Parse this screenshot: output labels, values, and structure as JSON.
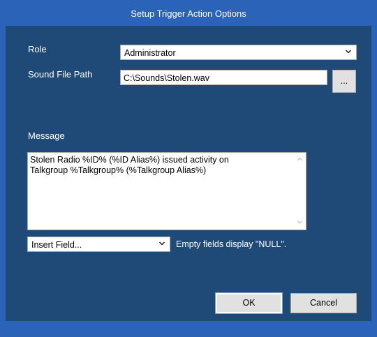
{
  "window": {
    "title": "Setup Trigger Action Options"
  },
  "role": {
    "label": "Role",
    "value": "Administrator"
  },
  "sound": {
    "label": "Sound File Path",
    "value": "C:\\Sounds\\Stolen.wav",
    "browse_label": "..."
  },
  "message": {
    "label": "Message",
    "text": "Stolen Radio %ID% (%ID Alias%) issued activity on\nTalkgroup %Talkgroup% (%Talkgroup Alias%)"
  },
  "insert_field": {
    "value": "Insert Field...",
    "hint": "Empty fields display \"NULL\"."
  },
  "buttons": {
    "ok_label": "OK",
    "cancel_label": "Cancel"
  },
  "colors": {
    "titlebar": "#2b63b8",
    "client": "#1f4a77",
    "text": "#ffffff"
  },
  "icons": {
    "combo_arrow": "chevron-down-icon",
    "scroll_up": "chevron-up-icon",
    "scroll_down": "chevron-down-icon"
  }
}
